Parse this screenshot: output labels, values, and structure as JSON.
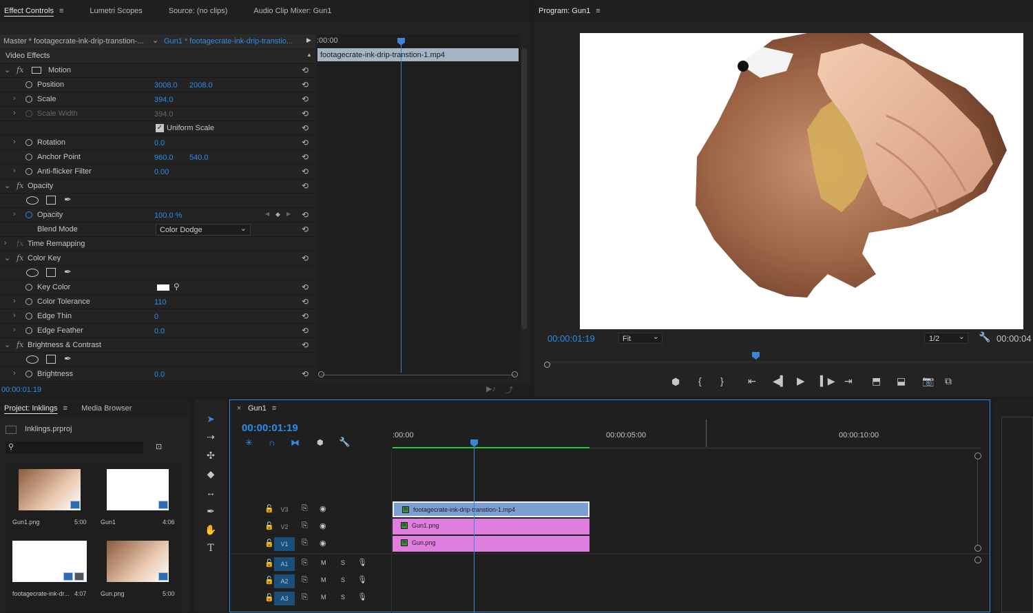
{
  "effect_panel": {
    "tabs": [
      "Effect Controls",
      "Lumetri Scopes",
      "Source: (no clips)",
      "Audio Clip Mixer: Gun1"
    ],
    "master_label": "Master * footagecrate-ink-drip-transtion-...",
    "clip_label": "Gun1 * footagecrate-ink-drip-transtio...",
    "section_title": "Video Effects",
    "timecode_start": ":00:00",
    "clip_bar_label": "footagecrate-ink-drip-transtion-1.mp4",
    "current_time": "00:00:01:19",
    "rows": {
      "motion": "Motion",
      "position_label": "Position",
      "position_x": "3008.0",
      "position_y": "2008.0",
      "scale_label": "Scale",
      "scale_value": "394.0",
      "scale_width_label": "Scale Width",
      "scale_width_value": "394.0",
      "uniform_scale": "Uniform Scale",
      "rotation_label": "Rotation",
      "rotation_value": "0.0",
      "anchor_label": "Anchor Point",
      "anchor_x": "960.0",
      "anchor_y": "540.0",
      "antiflicker_label": "Anti-flicker Filter",
      "antiflicker_value": "0.00",
      "opacity_group": "Opacity",
      "opacity_label": "Opacity",
      "opacity_value": "100.0 %",
      "blend_label": "Blend Mode",
      "blend_value": "Color Dodge",
      "time_remap": "Time Remapping",
      "color_key": "Color Key",
      "key_color_label": "Key Color",
      "tolerance_label": "Color Tolerance",
      "tolerance_value": "110",
      "edge_thin_label": "Edge Thin",
      "edge_thin_value": "0",
      "edge_feather_label": "Edge Feather",
      "edge_feather_value": "0.0",
      "bc_group": "Brightness & Contrast",
      "brightness_label": "Brightness",
      "brightness_value": "0.0"
    }
  },
  "program": {
    "title": "Program: Gun1",
    "timecode": "00:00:01:19",
    "fit": "Fit",
    "resolution": "1/2",
    "timecode_right": "00:00:04"
  },
  "project": {
    "tabs": [
      "Project: Inklings",
      "Media Browser"
    ],
    "file": "Inklings.prproj",
    "items": [
      {
        "name": "Gun1.png",
        "duration": "5:00"
      },
      {
        "name": "Gun1",
        "duration": "4:06"
      },
      {
        "name": "footagecrate-ink-dr...",
        "duration": "4:07"
      },
      {
        "name": "Gun.png",
        "duration": "5:00"
      }
    ]
  },
  "timeline": {
    "sequence": "Gun1",
    "timecode": "00:00:01:19",
    "ruler": [
      ":00:00",
      "00:00:05:00",
      "00:00:10:00"
    ],
    "tracks": {
      "v3": "V3",
      "v2": "V2",
      "v1": "V1",
      "a1": "A1",
      "a2": "A2",
      "a3": "A3",
      "m": "M",
      "s": "S"
    },
    "clips": {
      "v3": "footagecrate-ink-drip-transtion-1.mp4",
      "v2": "Gun1.png",
      "v1": "Gun.png"
    }
  },
  "colors": {
    "accent": "#2d8ceb",
    "playhead": "#3a86d6",
    "clip_pink": "#e07ee0",
    "clip_blue": "#7a9fd0",
    "work_area": "#27c93f"
  }
}
